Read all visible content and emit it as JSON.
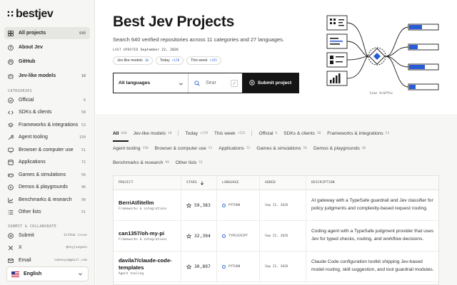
{
  "brand": {
    "mark": "∷",
    "name": "bestjev"
  },
  "nav": {
    "primary": [
      {
        "label": "All projects",
        "count": "640",
        "icon": "grid-icon",
        "active": true
      },
      {
        "label": "About Jev",
        "icon": "help-circle-icon"
      },
      {
        "label": "GitHub",
        "icon": "github-icon"
      },
      {
        "label": "Jev-like models",
        "count": "10",
        "icon": "bot-icon"
      }
    ],
    "categories_heading": "CATEGORIES",
    "categories": [
      {
        "label": "Official",
        "count": "6",
        "icon": "check-circle-icon"
      },
      {
        "label": "SDKs & clients",
        "count": "58",
        "icon": "code-icon"
      },
      {
        "label": "Frameworks & integrations",
        "count": "53",
        "icon": "layers-icon"
      },
      {
        "label": "Agent tooling",
        "count": "150",
        "icon": "tool-icon"
      },
      {
        "label": "Browser & computer use",
        "count": "51",
        "icon": "monitor-icon"
      },
      {
        "label": "Applications",
        "count": "72",
        "icon": "app-icon"
      },
      {
        "label": "Games & simulations",
        "count": "56",
        "icon": "gamepad-icon"
      },
      {
        "label": "Demos & playgrounds",
        "count": "46",
        "icon": "play-icon"
      },
      {
        "label": "Benchmarks & research",
        "count": "99",
        "icon": "chart-icon"
      },
      {
        "label": "Other lists",
        "count": "51",
        "icon": "list-icon"
      }
    ],
    "submit_heading": "SUBMIT & COLLABORATE",
    "submit": [
      {
        "label": "Submit",
        "meta": "GitHub issue",
        "icon": "plus-circle-icon"
      },
      {
        "label": "X",
        "meta": "@heyjungwon",
        "icon": "x-icon"
      },
      {
        "label": "Email",
        "meta": "someuyx@gmail.com",
        "icon": "mail-icon"
      }
    ],
    "language": "English"
  },
  "hero": {
    "title": "Best Jev Projects",
    "subtitle": "Search 640 verified repositories across 11 categories and 27 languages.",
    "updated_label": "LAST UPDATED",
    "updated_date": "September 22, 2026",
    "pills": [
      {
        "label": "Jev-like models",
        "value": "10"
      },
      {
        "label": "Today",
        "value": "+178"
      },
      {
        "label": "This week",
        "value": "+155"
      }
    ],
    "language_select": "All languages",
    "search_placeholder": "Sear",
    "submit_label": "Submit project",
    "diagram_caption": "live traffic"
  },
  "filters": {
    "row1": [
      {
        "label": "All",
        "count": "640",
        "active": true
      },
      {
        "label": "Jev-like models",
        "count": "10"
      },
      {
        "label": "Today",
        "count": "+178"
      },
      {
        "label": "This week",
        "count": "+155"
      },
      {
        "label": "Official",
        "count": "6"
      },
      {
        "label": "SDKs & clients",
        "count": "58"
      },
      {
        "label": "Frameworks & integrations",
        "count": "53"
      }
    ],
    "row2": [
      {
        "label": "Agent tooling",
        "count": "150"
      },
      {
        "label": "Browser & computer use",
        "count": "51"
      },
      {
        "label": "Applications",
        "count": "72"
      },
      {
        "label": "Games & simulations",
        "count": "56"
      },
      {
        "label": "Demos & playgrounds",
        "count": "46"
      }
    ],
    "row3": [
      {
        "label": "Benchmarks & research",
        "count": "99"
      },
      {
        "label": "Other lists",
        "count": "51"
      }
    ]
  },
  "table": {
    "columns": {
      "project": "PROJECT",
      "stars": "STARS",
      "language": "LANGUAGE",
      "added": "ADDED",
      "description": "DESCRIPTION"
    },
    "rows": [
      {
        "name": "BerriAI/litellm",
        "category": "Frameworks & integrations",
        "stars": "59,383",
        "language": "PYTHON",
        "added": "Sep 22, 2026",
        "description": "AI gateway with a TypeSafe guardrail and Jev classifier for policy judgments and complexity-based request routing."
      },
      {
        "name": "can1357/oh-my-pi",
        "category": "Frameworks & integrations",
        "stars": "32,394",
        "language": "TYPESCRIPT",
        "added": "Sep 22, 2026",
        "description": "Coding agent with a TypeSafe judgment provider that uses Jev for typed checks, routing, and workflow decisions."
      },
      {
        "name": "davila7/claude-code-templates",
        "category": "Agent tooling",
        "stars": "30,897",
        "language": "PYTHON",
        "added": "Sep 22, 2026",
        "description": "Claude Code configuration toolkit shipping Jev-based model routing, skill suggestion, and tool guardrail modules."
      }
    ]
  }
}
